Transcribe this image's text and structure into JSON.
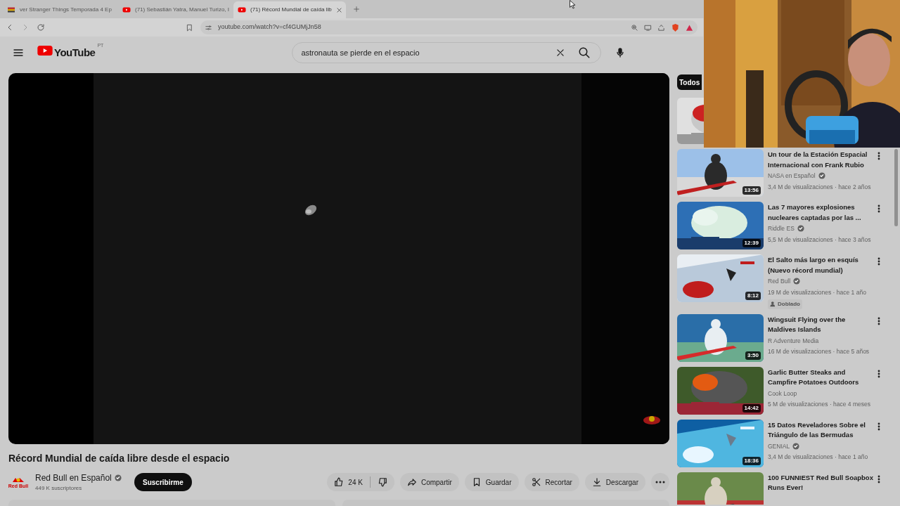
{
  "browser": {
    "tabs": [
      {
        "kind": "site",
        "title": "ver Stranger Things Temporada 4 Ep",
        "selected": false
      },
      {
        "kind": "youtube",
        "title": "(71) Sebastián Yatra, Manuel Turizo, I",
        "selected": false
      },
      {
        "kind": "youtube",
        "title": "(71) Récord Mundial de caída lib",
        "selected": true
      }
    ],
    "url": "youtube.com/watch?v=cf4GUMjJn58"
  },
  "header": {
    "logo": "YouTube",
    "region": "PT",
    "search": "astronauta se pierde en el espacio"
  },
  "video": {
    "title": "Récord Mundial de caída libre desde el espacio",
    "channel": "Red Bull en Español",
    "channel_logo": "Red Bull",
    "verified": true,
    "subscribers": "449 K suscriptores",
    "subscribe": "Suscribirme",
    "likes": "24 K",
    "actions": [
      {
        "kind": "share",
        "label": "Compartir"
      },
      {
        "kind": "save",
        "label": "Guardar"
      },
      {
        "kind": "clip",
        "label": "Recortar"
      },
      {
        "kind": "download",
        "label": "Descargar"
      }
    ]
  },
  "chips": [
    {
      "label": "Todos",
      "selected": true
    }
  ],
  "recommendations": [
    {
      "title": "Un tour de la Estación Espacial Internacional con Frank Rubio",
      "channel": "NASA en Español",
      "verified": true,
      "meta": "3,4 M de visualizaciones · hace 2 años",
      "duration": "13:56"
    },
    {
      "title": "Las 7 mayores explosiones nucleares captadas por las ...",
      "channel": "Riddle ES",
      "verified": true,
      "meta": "5,5 M de visualizaciones · hace 3 años",
      "duration": "12:39"
    },
    {
      "title": "El Salto más largo en esquís (Nuevo récord mundial)",
      "channel": "Red Bull",
      "verified": true,
      "meta": "19 M de visualizaciones · hace 1 año",
      "duration": "8:12",
      "badge": "Doblado"
    },
    {
      "title": "Wingsuit Flying over the Maldives Islands",
      "channel": "R Adventure Media",
      "verified": false,
      "meta": "16 M de visualizaciones · hace 5 años",
      "duration": "3:50"
    },
    {
      "title": "Garlic Butter Steaks and Campfire Potatoes Outdoors",
      "channel": "Cook Loop",
      "verified": false,
      "meta": "5 M de visualizaciones · hace 4 meses",
      "duration": "14:42"
    },
    {
      "title": "15 Datos Reveladores Sobre el Triángulo de las Bermudas",
      "channel": "GENIAL",
      "verified": true,
      "meta": "3,4 M de visualizaciones · hace 1 año",
      "duration": "18:36"
    },
    {
      "title": "100 FUNNIEST Red Bull Soapbox Runs Ever!"
    }
  ]
}
